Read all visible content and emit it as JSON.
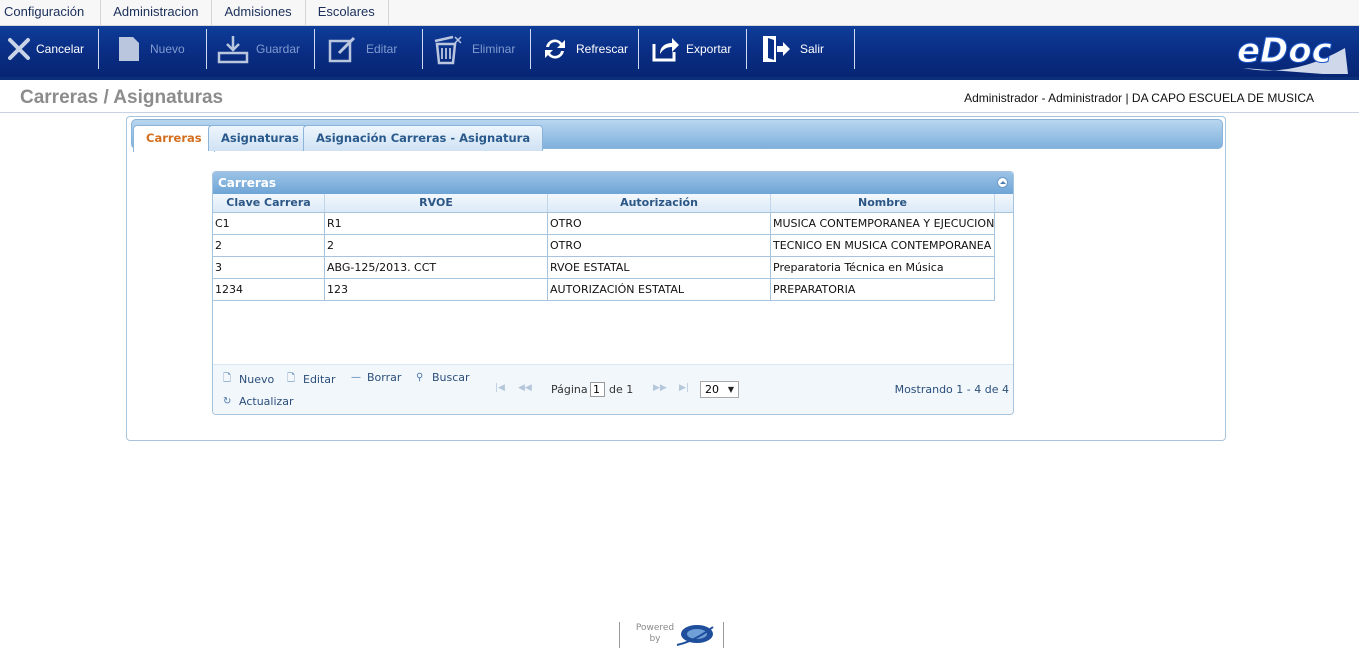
{
  "menu": [
    "Configuración",
    "Administracion",
    "Admisiones",
    "Escolares"
  ],
  "toolbar": {
    "cancel": "Cancelar",
    "new": "Nuevo",
    "save": "Guardar",
    "edit": "Editar",
    "delete": "Eliminar",
    "refresh": "Refrescar",
    "export": "Exportar",
    "exit": "Salir",
    "logo": "eDoc"
  },
  "header": {
    "title": "Carreras / Asignaturas",
    "user": "Administrador - Administrador | DA CAPO ESCUELA DE MUSICA"
  },
  "tabs": [
    "Carreras",
    "Asignaturas",
    "Asignación Carreras - Asignatura"
  ],
  "grid": {
    "caption": "Carreras",
    "columns": [
      "Clave Carrera",
      "RVOE",
      "Autorización",
      "Nombre"
    ],
    "rows": [
      [
        "C1",
        "R1",
        "OTRO",
        "MUSICA CONTEMPORANEA Y EJECUCION"
      ],
      [
        "2",
        "2",
        "OTRO",
        "TECNICO EN MUSICA CONTEMPORANEA Y"
      ],
      [
        "3",
        "ABG-125/2013. CCT",
        "RVOE ESTATAL",
        "Preparatoria Técnica en Música"
      ],
      [
        "1234",
        "123",
        "AUTORIZACIÓN ESTATAL",
        "PREPARATORIA"
      ]
    ],
    "pager": {
      "new": "Nuevo",
      "edit": "Editar",
      "delete": "Borrar",
      "search": "Buscar",
      "refresh": "Actualizar",
      "page_label": "Página",
      "page_value": "1",
      "of_label": "de 1",
      "rows_per_page": "20",
      "records": "Mostrando 1 - 4 de 4"
    }
  },
  "footer": {
    "powered": "Powered",
    "by": "by"
  }
}
